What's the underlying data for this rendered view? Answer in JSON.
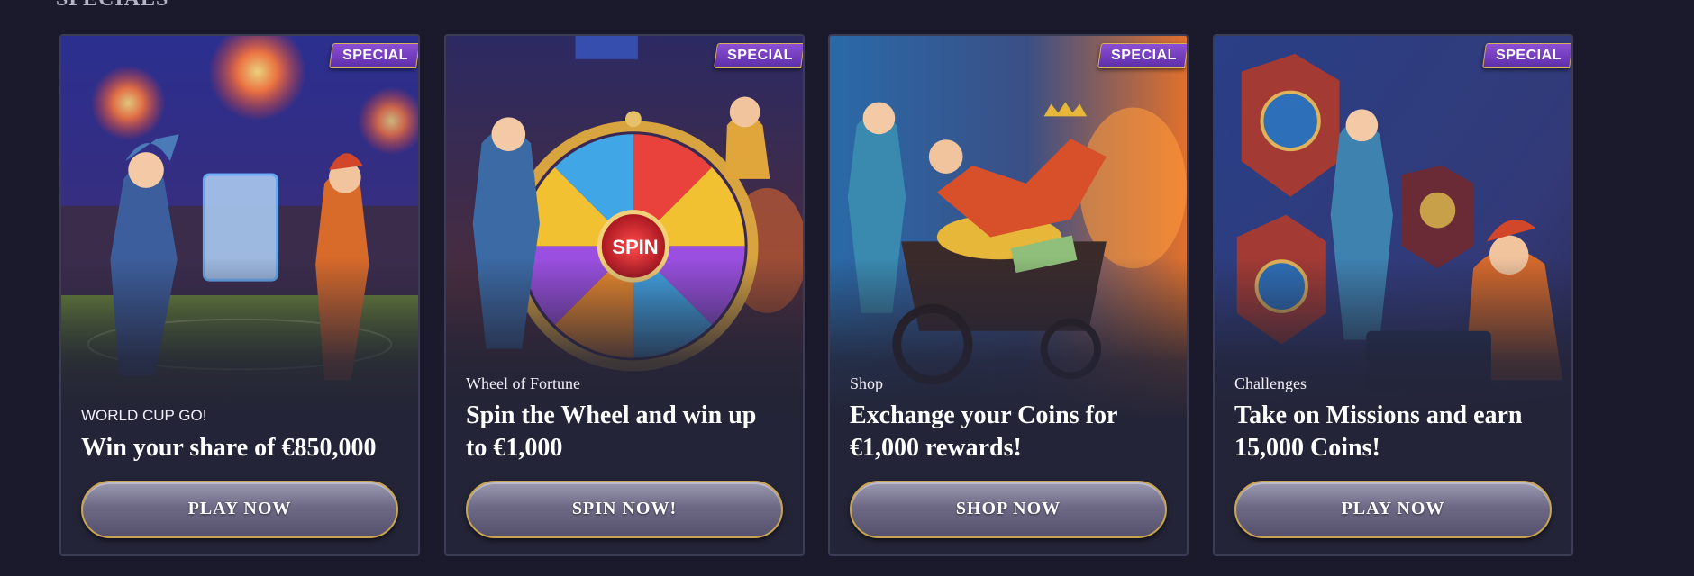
{
  "section": {
    "title": "SPECIALS"
  },
  "colors": {
    "background": "#1a1a2c",
    "card": "#232437",
    "badge": "#7a41c4",
    "button_border": "#c9a451"
  },
  "cards": [
    {
      "badge": "SPECIAL",
      "eyebrow": "WORLD CUP GO!",
      "headline": "Win your share of €850,000",
      "cta": "PLAY NOW",
      "art": "jesters-stadium-fireworks"
    },
    {
      "badge": "SPECIAL",
      "eyebrow": "Wheel of Fortune",
      "headline": "Spin the Wheel and win up to €1,000",
      "cta": "SPIN NOW!",
      "art": "jesters-spin-wheel",
      "wheel_label": "SPIN"
    },
    {
      "badge": "SPECIAL",
      "eyebrow": "Shop",
      "headline": "Exchange your Coins for €1,000 rewards!",
      "cta": "SHOP NOW",
      "art": "jesters-treasure-cart"
    },
    {
      "badge": "SPECIAL",
      "eyebrow": "Challenges",
      "headline": "Take on Missions and earn 15,000 Coins!",
      "cta": "PLAY NOW",
      "art": "jesters-mission-shields"
    }
  ]
}
